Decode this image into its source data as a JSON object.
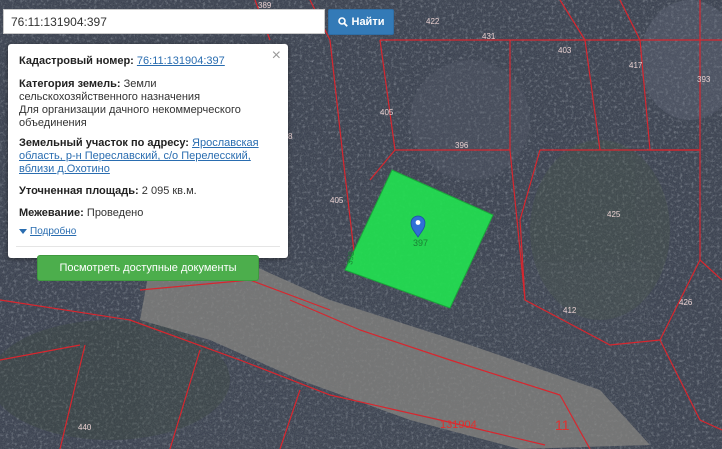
{
  "search": {
    "value": "76:11:131904:397",
    "button_label": "Найти"
  },
  "popup": {
    "cadastral_label": "Кадастровый номер:",
    "cadastral_number": "76:11:131904:397",
    "category_label": "Категория земель:",
    "category_value": "Земли сельскохозяйственного назначения",
    "category_use": "Для организации дачного некоммерческого объединения",
    "address_label": "Земельный участок по адресу:",
    "address_value": "Ярославская область, р-н Переславский, с/о Перелесский, вблизи д.Охотино",
    "area_label": "Уточненная площадь:",
    "area_value": "2 095 кв.м.",
    "survey_label": "Межевание:",
    "survey_value": "Проведено",
    "more_link": "Подробно",
    "docs_button": "Посмотреть доступные документы",
    "close_symbol": "×"
  },
  "map": {
    "parcel_labels": [
      "389",
      "422",
      "431",
      "403",
      "417",
      "393",
      "405",
      "396",
      "405",
      "425",
      "412",
      "426",
      "440",
      "131904",
      "11",
      "8"
    ],
    "highlight_color": "#22e050",
    "boundary_color": "#d8262e"
  },
  "icons": {
    "search": "search-icon",
    "close": "close-icon",
    "marker": "map-marker-icon",
    "more": "caret-down-icon"
  }
}
